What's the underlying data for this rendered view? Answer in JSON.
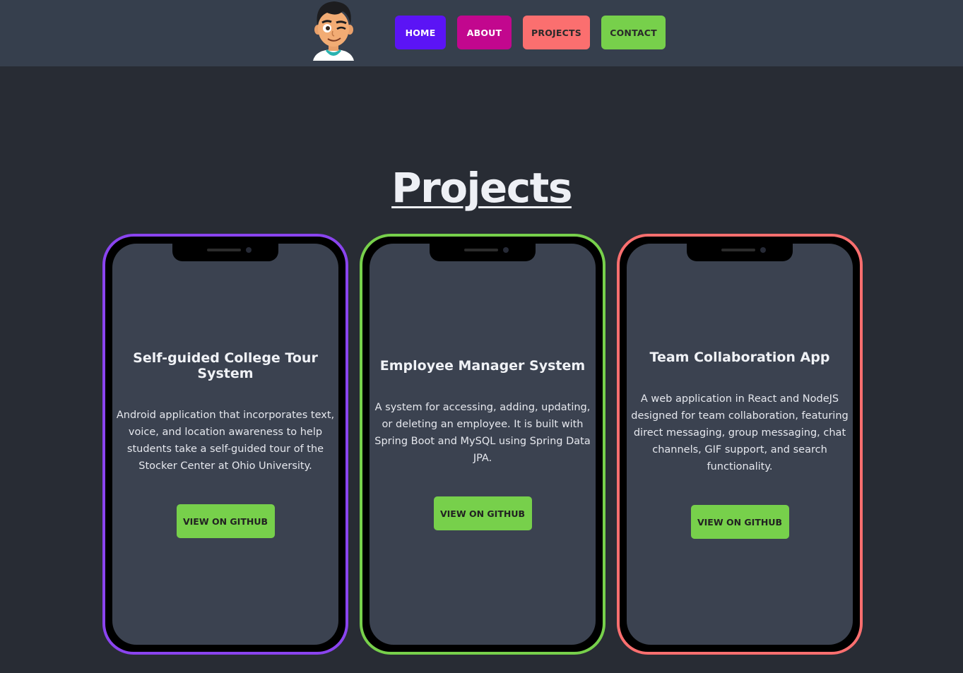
{
  "nav": {
    "home": "HOME",
    "about": "ABOUT",
    "projects": "PROJECTS",
    "contact": "CONTACT"
  },
  "page_title": "Projects",
  "projects": [
    {
      "title": "Self-guided College Tour System",
      "description": "Android application that incorporates text, voice, and location awareness to help students take a self-guided tour of the Stocker Center at Ohio University.",
      "button": "VIEW ON GITHUB",
      "accent": "#8a44ef"
    },
    {
      "title": "Employee Manager System",
      "description": "A system for accessing, adding, updating, or deleting an employee. It is built with Spring Boot and MySQL using Spring Data JPA.",
      "button": "VIEW ON GITHUB",
      "accent": "#77d04b"
    },
    {
      "title": "Team Collaboration App",
      "description": "A web application in React and NodeJS designed for team collaboration, featuring direct messaging, group messaging, chat channels, GIF support, and search functionality.",
      "button": "VIEW ON GITHUB",
      "accent": "#fb6f6f"
    }
  ],
  "colors": {
    "header_bg": "#363f4d",
    "page_bg": "#282c34",
    "home": "#5b14f5",
    "about": "#c2078e",
    "projects": "#fb6f6f",
    "contact": "#77d04b"
  },
  "icons": {
    "avatar": "winking-avatar-icon"
  }
}
